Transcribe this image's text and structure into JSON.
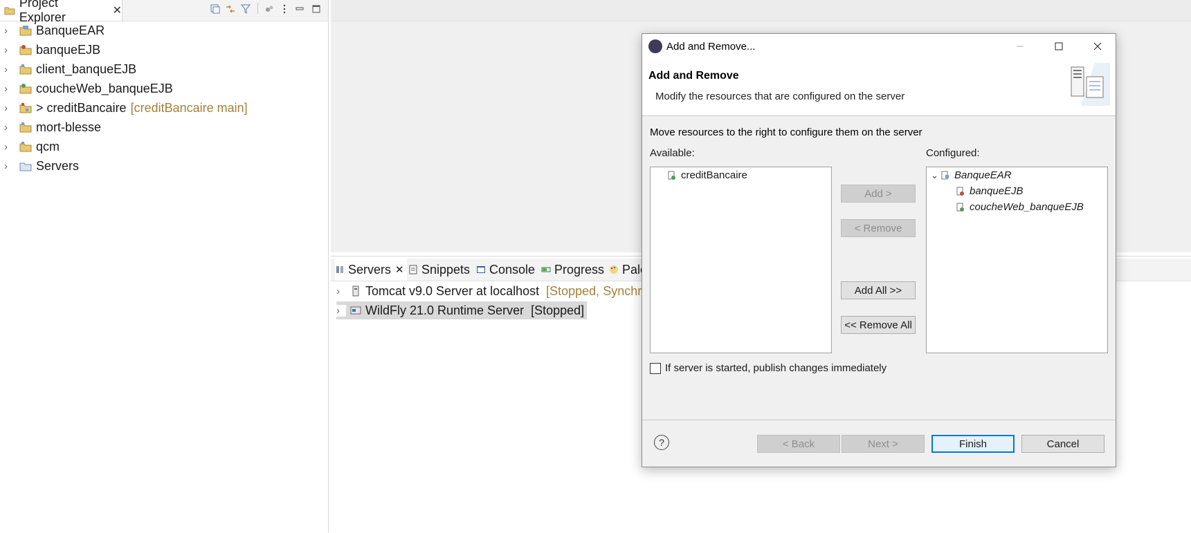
{
  "project_explorer": {
    "tab_label": "Project Explorer",
    "close_glyph": "✕",
    "toolbar_icons": [
      "collapse-all-icon",
      "link-with-editor-icon",
      "filter-icon",
      "focus-icon",
      "view-menu-icon",
      "minimize-icon",
      "maximize-icon"
    ],
    "items": [
      {
        "label": "BanqueEAR",
        "icon": "ear-project-icon",
        "decoration": ""
      },
      {
        "label": "banqueEJB",
        "icon": "ejb-project-icon",
        "decoration": ""
      },
      {
        "label": "client_banqueEJB",
        "icon": "project-icon",
        "decoration": ""
      },
      {
        "label": "coucheWeb_banqueEJB",
        "icon": "web-project-icon",
        "decoration": ""
      },
      {
        "label": "> creditBancaire",
        "icon": "git-project-icon",
        "decoration": "[creditBancaire main]"
      },
      {
        "label": "mort-blesse",
        "icon": "project-icon",
        "decoration": ""
      },
      {
        "label": "qcm",
        "icon": "project-icon",
        "decoration": ""
      },
      {
        "label": "Servers",
        "icon": "folder-icon",
        "decoration": ""
      }
    ]
  },
  "bottom_panel": {
    "tabs": [
      {
        "label": "Servers",
        "icon": "servers-icon"
      },
      {
        "label": "Snippets",
        "icon": "snippets-icon"
      },
      {
        "label": "Console",
        "icon": "console-icon"
      },
      {
        "label": "Progress",
        "icon": "progress-icon"
      },
      {
        "label": "Pale",
        "icon": "palette-icon"
      }
    ],
    "close_glyph": "✕",
    "servers": [
      {
        "name": "Tomcat v9.0 Server at localhost",
        "status": "[Stopped, Synchror"
      },
      {
        "name": "WildFly 21.0 Runtime Server",
        "status": "[Stopped]"
      }
    ]
  },
  "dialog": {
    "window_title": "Add and Remove...",
    "banner_title": "Add and Remove",
    "banner_description": "Modify the resources that are configured on the server",
    "instruction": "Move resources to the right to configure them on the server",
    "available_label": "Available:",
    "configured_label": "Configured:",
    "available_items": [
      "creditBancaire"
    ],
    "configured_tree": {
      "root": "BanqueEAR",
      "children": [
        "banqueEJB",
        "coucheWeb_banqueEJB"
      ]
    },
    "buttons": {
      "add": "Add >",
      "remove": "< Remove",
      "add_all": "Add All >>",
      "remove_all": "<< Remove All",
      "back": "< Back",
      "next": "Next >",
      "finish": "Finish",
      "cancel": "Cancel"
    },
    "publish_checkbox_label": "If server is started, publish changes immediately",
    "publish_checked": false,
    "help_glyph": "?"
  },
  "colors": {
    "decoration": "#a6803a",
    "default_button_border": "#0078d7"
  }
}
